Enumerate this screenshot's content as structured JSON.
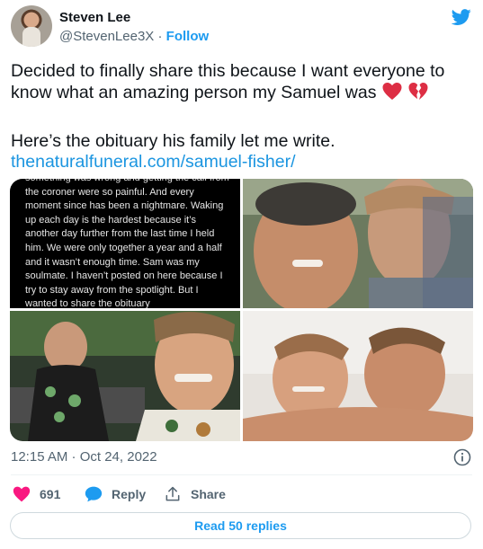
{
  "author": {
    "name": "Steven Lee",
    "handle": "@StevenLee3X",
    "separator": "·",
    "follow_label": "Follow"
  },
  "tweet": {
    "line1": "Decided to finally share this because I want everyone to know what an amazing person my Samuel was",
    "line2": "Here’s the obituary his family let me write.",
    "link": "thenaturalfuneral.com/samuel-fisher/",
    "obituary_excerpt": "something was wrong and getting the call from the coroner were so painful. And every moment since has been a nightmare. Waking up each day is the hardest because it’s another day further from the last time I held him. We were only together a year and a half and it wasn’t enough time. Sam was my soulmate. I haven’t posted on here because I try to stay away from the spotlight. But I wanted to share the obituary"
  },
  "meta": {
    "timestamp": "12:15 AM · Oct 24, 2022"
  },
  "actions": {
    "likes": "691",
    "reply_label": "Reply",
    "share_label": "Share"
  },
  "read_replies_label": "Read 50 replies",
  "icons": {
    "brand": "twitter-bird-icon",
    "emoji": [
      "red-heart-icon",
      "broken-heart-icon"
    ],
    "info": "info-icon",
    "like": "heart-icon",
    "reply": "speech-bubble-icon",
    "share": "share-upload-icon"
  },
  "colors": {
    "twitter_blue": "#1d9bf0",
    "like_pink": "#f91880",
    "text": "#0f1419",
    "muted": "#536471"
  }
}
